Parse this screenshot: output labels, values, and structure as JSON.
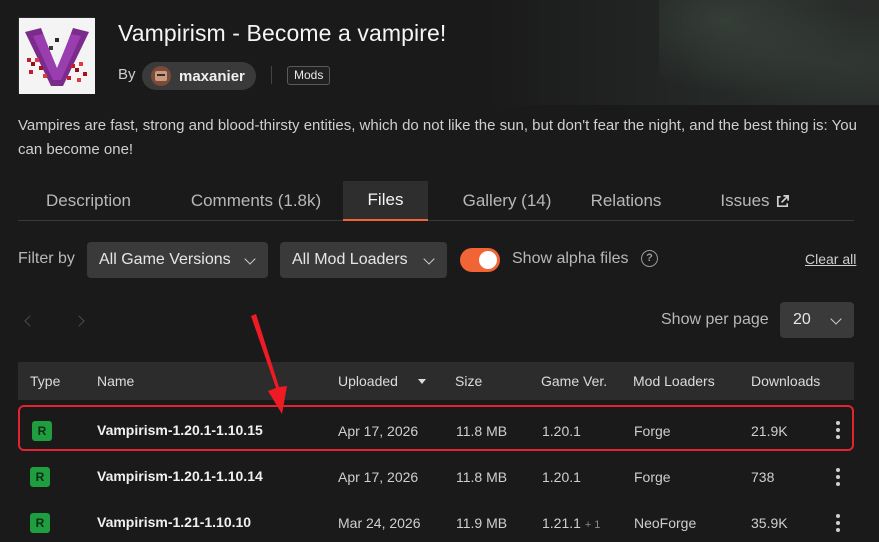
{
  "project": {
    "title": "Vampirism - Become a vampire!",
    "by_label": "By",
    "author": "maxanier",
    "category": "Mods",
    "summary": "Vampires are fast, strong and blood-thirsty entities, which do not like the sun, but don't fear the night, and the best thing is: You can become one!"
  },
  "tabs": [
    {
      "label": "Description"
    },
    {
      "label": "Comments (1.8k)"
    },
    {
      "label": "Files"
    },
    {
      "label": "Gallery (14)"
    },
    {
      "label": "Relations"
    },
    {
      "label": "Issues"
    }
  ],
  "filters": {
    "label": "Filter by",
    "game_versions": "All Game Versions",
    "mod_loaders": "All Mod Loaders",
    "show_alpha_label": "Show alpha files",
    "show_alpha_enabled": true,
    "clear_all": "Clear all"
  },
  "pagination": {
    "per_page_label": "Show per page",
    "per_page_value": "20"
  },
  "table": {
    "columns": [
      "Type",
      "Name",
      "Uploaded",
      "Size",
      "Game Ver.",
      "Mod Loaders",
      "Downloads"
    ],
    "rows": [
      {
        "type": "R",
        "name": "Vampirism-1.20.1-1.10.15",
        "uploaded": "Apr 17, 2026",
        "size": "11.8 MB",
        "game_ver": "1.20.1",
        "game_ver_extra": "",
        "loader": "Forge",
        "downloads": "21.9K",
        "highlighted": true
      },
      {
        "type": "R",
        "name": "Vampirism-1.20.1-1.10.14",
        "uploaded": "Apr 17, 2026",
        "size": "11.8 MB",
        "game_ver": "1.20.1",
        "game_ver_extra": "",
        "loader": "Forge",
        "downloads": "738",
        "highlighted": false
      },
      {
        "type": "R",
        "name": "Vampirism-1.21-1.10.10",
        "uploaded": "Mar 24, 2026",
        "size": "11.9 MB",
        "game_ver": "1.21.1",
        "game_ver_extra": "+ 1",
        "loader": "NeoForge",
        "downloads": "35.9K",
        "highlighted": false
      }
    ]
  },
  "colors": {
    "accent": "#f16436",
    "release_badge": "#1e9e3e",
    "highlight_border": "#e32330",
    "background": "#1a1a1a"
  }
}
